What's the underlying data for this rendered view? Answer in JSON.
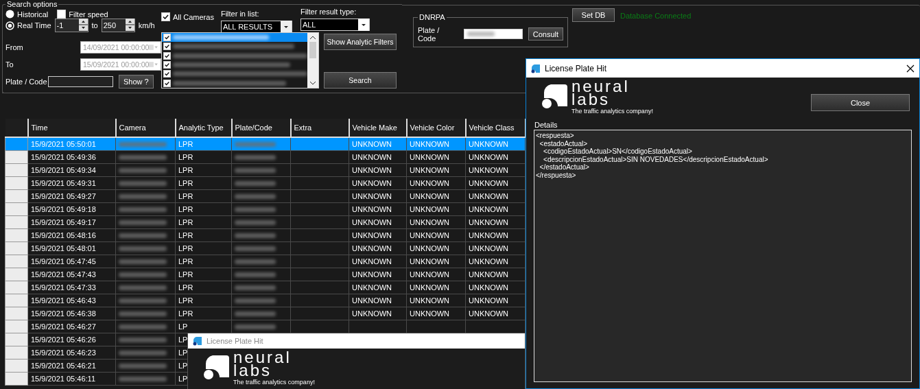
{
  "search_options": {
    "title": "Search options",
    "mode": [
      {
        "label": "Historical",
        "selected": false
      },
      {
        "label": "Real Time",
        "selected": true
      }
    ],
    "filter_speed": {
      "label": "Filter speed",
      "checked": false
    },
    "speed_min": "-1",
    "speed_to": "to",
    "speed_max": "250",
    "speed_unit": "km/h",
    "from": {
      "label": "From",
      "value": "14/09/2021 00:00:00",
      "disabled": true
    },
    "to": {
      "label": "To",
      "value": "15/09/2021 00:00:00",
      "disabled": true
    },
    "plate": {
      "label": "Plate / Code",
      "button": "Show ?"
    },
    "all_cameras": {
      "label": "All Cameras",
      "checked": true
    },
    "camera_list": [
      {
        "checked": true,
        "selected": true
      },
      {
        "checked": true,
        "selected": false
      },
      {
        "checked": true,
        "selected": false
      },
      {
        "checked": true,
        "selected": false
      },
      {
        "checked": true,
        "selected": false
      },
      {
        "checked": true,
        "selected": false
      }
    ],
    "filter_in_list": {
      "label": "Filter in list:",
      "value": "ALL RESULTS"
    },
    "filter_result_type": {
      "label": "Filter result type:",
      "value": "ALL"
    },
    "buttons": [
      "Show Analytic Filters",
      "Search"
    ]
  },
  "dnrpa": {
    "title": "DNRPA",
    "label": "Plate / Code",
    "button": "Consult"
  },
  "set_db_button": "Set DB",
  "db_status": "Database Connected",
  "table": {
    "columns": [
      "Time",
      "Camera",
      "Analytic Type",
      "Plate/Code",
      "Extra",
      "Vehicle Make",
      "Vehicle Color",
      "Vehicle Class"
    ],
    "rows": [
      {
        "selected": true,
        "time": "15/9/2021 05:50:01",
        "analytic_type": "LPR",
        "vehicle_make": "UNKNOWN",
        "vehicle_color": "UNKNOWN",
        "vehicle_class": "UNKNOWN"
      },
      {
        "selected": false,
        "time": "15/9/2021 05:49:36",
        "analytic_type": "LPR",
        "vehicle_make": "UNKNOWN",
        "vehicle_color": "UNKNOWN",
        "vehicle_class": "UNKNOWN"
      },
      {
        "selected": false,
        "time": "15/9/2021 05:49:34",
        "analytic_type": "LPR",
        "vehicle_make": "UNKNOWN",
        "vehicle_color": "UNKNOWN",
        "vehicle_class": "UNKNOWN"
      },
      {
        "selected": false,
        "time": "15/9/2021 05:49:31",
        "analytic_type": "LPR",
        "vehicle_make": "UNKNOWN",
        "vehicle_color": "UNKNOWN",
        "vehicle_class": "UNKNOWN"
      },
      {
        "selected": false,
        "time": "15/9/2021 05:49:27",
        "analytic_type": "LPR",
        "vehicle_make": "UNKNOWN",
        "vehicle_color": "UNKNOWN",
        "vehicle_class": "UNKNOWN"
      },
      {
        "selected": false,
        "time": "15/9/2021 05:49:18",
        "analytic_type": "LPR",
        "vehicle_make": "UNKNOWN",
        "vehicle_color": "UNKNOWN",
        "vehicle_class": "UNKNOWN"
      },
      {
        "selected": false,
        "time": "15/9/2021 05:49:17",
        "analytic_type": "LPR",
        "vehicle_make": "UNKNOWN",
        "vehicle_color": "UNKNOWN",
        "vehicle_class": "UNKNOWN"
      },
      {
        "selected": false,
        "time": "15/9/2021 05:48:16",
        "analytic_type": "LPR",
        "vehicle_make": "UNKNOWN",
        "vehicle_color": "UNKNOWN",
        "vehicle_class": "UNKNOWN"
      },
      {
        "selected": false,
        "time": "15/9/2021 05:48:01",
        "analytic_type": "LPR",
        "vehicle_make": "UNKNOWN",
        "vehicle_color": "UNKNOWN",
        "vehicle_class": "UNKNOWN"
      },
      {
        "selected": false,
        "time": "15/9/2021 05:47:45",
        "analytic_type": "LPR",
        "vehicle_make": "UNKNOWN",
        "vehicle_color": "UNKNOWN",
        "vehicle_class": "UNKNOWN"
      },
      {
        "selected": false,
        "time": "15/9/2021 05:47:43",
        "analytic_type": "LPR",
        "vehicle_make": "UNKNOWN",
        "vehicle_color": "UNKNOWN",
        "vehicle_class": "UNKNOWN"
      },
      {
        "selected": false,
        "time": "15/9/2021 05:47:33",
        "analytic_type": "LPR",
        "vehicle_make": "UNKNOWN",
        "vehicle_color": "UNKNOWN",
        "vehicle_class": "UNKNOWN"
      },
      {
        "selected": false,
        "time": "15/9/2021 05:46:43",
        "analytic_type": "LPR",
        "vehicle_make": "UNKNOWN",
        "vehicle_color": "UNKNOWN",
        "vehicle_class": "UNKNOWN"
      },
      {
        "selected": false,
        "time": "15/9/2021 05:46:38",
        "analytic_type": "LPR",
        "vehicle_make": "UNKNOWN",
        "vehicle_color": "UNKNOWN",
        "vehicle_class": "UNKNOWN"
      },
      {
        "selected": false,
        "time": "15/9/2021 05:46:27",
        "analytic_type": "LP"
      },
      {
        "selected": false,
        "time": "15/9/2021 05:46:26",
        "analytic_type": "LP"
      },
      {
        "selected": false,
        "time": "15/9/2021 05:46:23",
        "analytic_type": "LP"
      },
      {
        "selected": false,
        "time": "15/9/2021 05:46:21",
        "analytic_type": "LP"
      },
      {
        "selected": false,
        "time": "15/9/2021 05:46:11",
        "analytic_type": "LP"
      }
    ]
  },
  "windows": [
    {
      "title": "License Plate Hit",
      "active": true,
      "logo": {
        "line_1": "neural",
        "line_2": "labs",
        "tagline": "The traffic analytics company!"
      },
      "close_button": "Close",
      "details_label": "Details",
      "details": "<respuesta>\n  <estadoActual>\n    <codigoEstadoActual>SN</codigoEstadoActual>\n    <descripcionEstadoActual>SIN NOVEDADES</descripcionEstadoActual>\n  </estadoActual>\n</respuesta>"
    },
    {
      "title": "License Plate Hit",
      "active": false,
      "logo": {
        "line_1": "neural",
        "line_2": "labs",
        "tagline": "The traffic analytics company!"
      }
    }
  ]
}
